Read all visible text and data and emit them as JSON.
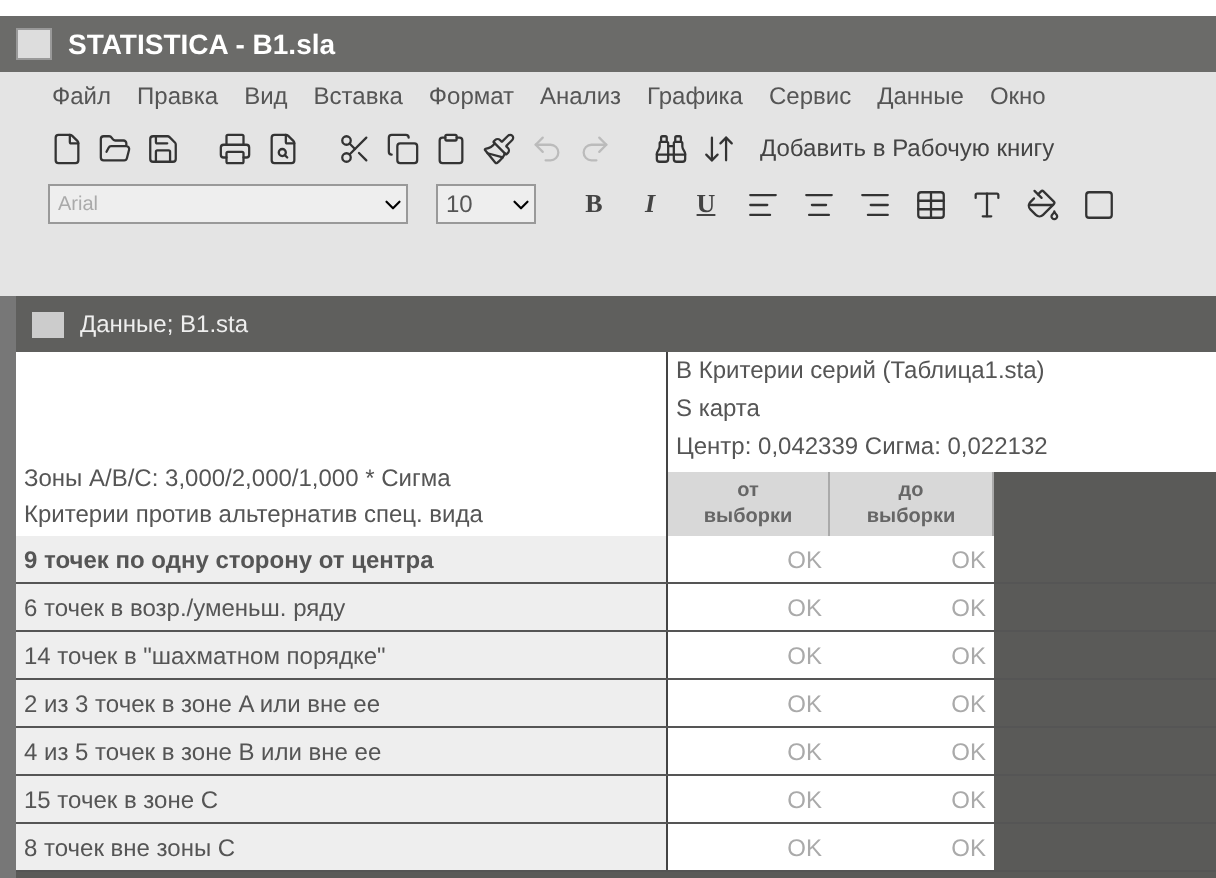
{
  "window": {
    "title": "STATISTICA - B1.sla"
  },
  "menu": [
    "Файл",
    "Правка",
    "Вид",
    "Вставка",
    "Формат",
    "Анализ",
    "Графика",
    "Сервис",
    "Данные",
    "Окно"
  ],
  "toolbar": {
    "add_button": "Добавить в Рабочую книгу"
  },
  "format_bar": {
    "font": "Arial",
    "size": "10",
    "bold": "B",
    "italic": "I",
    "underline": "U"
  },
  "data_window": {
    "title": "Данные; B1.sta",
    "header_left": [
      "Зоны  A/B/C:  3,000/2,000/1,000  * Сигма",
      "Критерии против альтернатив спец. вида"
    ],
    "header_right": [
      "B   Критерии серий (Таблица1.sta)",
      "S карта",
      "Центр: 0,042339 Сигма: 0,022132"
    ],
    "columns": [
      "от выборки",
      "до выборки"
    ],
    "rows": [
      {
        "label": "9 точек по одну сторону от центра",
        "bold": true,
        "values": [
          "OK",
          "OK"
        ]
      },
      {
        "label": "6 точек в возр./уменьш. ряду",
        "bold": false,
        "values": [
          "OK",
          "OK"
        ]
      },
      {
        "label": "14 точек в \"шахматном порядке\"",
        "bold": false,
        "values": [
          "OK",
          "OK"
        ]
      },
      {
        "label": "2 из  3 точек в зоне A или вне ее",
        "bold": false,
        "values": [
          "OK",
          "OK"
        ]
      },
      {
        "label": "4 из  5 точек в зоне B или вне ее",
        "bold": false,
        "values": [
          "OK",
          "OK"
        ]
      },
      {
        "label": "15 точек в зоне C",
        "bold": false,
        "values": [
          "OK",
          "OK"
        ]
      },
      {
        "label": "8 точек вне зоны C",
        "bold": false,
        "values": [
          "OK",
          "OK"
        ]
      }
    ]
  }
}
